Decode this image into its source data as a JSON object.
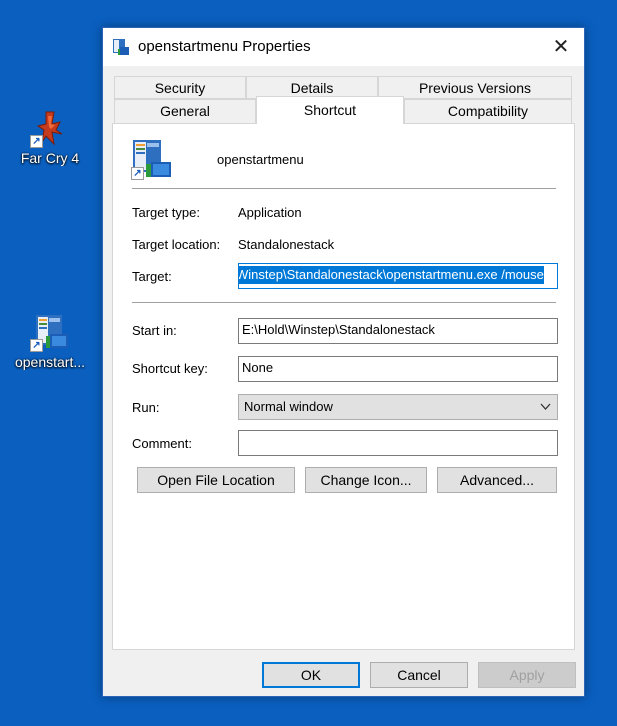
{
  "desktop": {
    "icons": [
      {
        "label": "Far Cry 4"
      },
      {
        "label": "openstart..."
      }
    ]
  },
  "dialog": {
    "title": "openstartmenu Properties",
    "close_glyph": "✕",
    "tabs_back": [
      "Security",
      "Details",
      "Previous Versions"
    ],
    "tabs_front": [
      "General",
      "Shortcut",
      "Compatibility"
    ],
    "active_tab": "Shortcut",
    "shortcut_name": "openstartmenu",
    "target_type_label": "Target type:",
    "target_type": "Application",
    "target_location_label": "Target location:",
    "target_location": "Standalonestack",
    "target_label": "Target:",
    "target_value": "Winstep\\Standalonestack\\openstartmenu.exe /mouse",
    "start_in_label": "Start in:",
    "start_in_value": "E:\\Hold\\Winstep\\Standalonestack",
    "shortcut_key_label": "Shortcut key:",
    "shortcut_key_value": "None",
    "run_label": "Run:",
    "run_value": "Normal window",
    "comment_label": "Comment:",
    "comment_value": "",
    "open_file_location": "Open File Location",
    "change_icon": "Change Icon...",
    "advanced": "Advanced...",
    "ok": "OK",
    "cancel": "Cancel",
    "apply": "Apply"
  },
  "colors": {
    "desktop_bg": "#0a5fbf",
    "accent": "#0078d7"
  },
  "icons": [
    "far-cry-4-icon",
    "openstartmenu-icon",
    "shortcut-arrow-icon",
    "close-icon",
    "chevron-down-icon"
  ]
}
